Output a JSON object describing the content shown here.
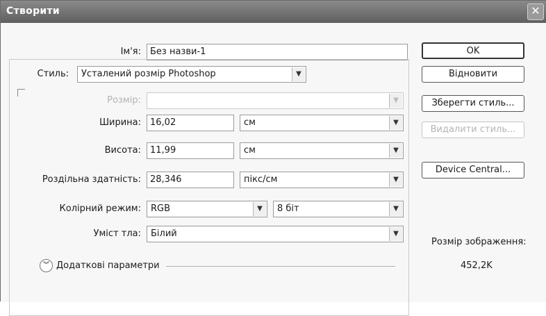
{
  "window": {
    "title": "Створити",
    "close_glyph": "✕"
  },
  "form": {
    "name_label": "Ім'я:",
    "name_value": "Без назви-1",
    "style_label": "Стиль:",
    "style_value": "Усталений розмір Photoshop",
    "size_label": "Розмір:",
    "size_value": "",
    "width_label": "Ширина:",
    "width_value": "16,02",
    "width_unit": "см",
    "height_label": "Висота:",
    "height_value": "11,99",
    "height_unit": "см",
    "resolution_label": "Роздільна здатність:",
    "resolution_value": "28,346",
    "resolution_unit": "пікс/см",
    "colormode_label": "Колірний режим:",
    "colormode_value": "RGB",
    "bitdepth_value": "8 біт",
    "background_label": "Уміст тла:",
    "background_value": "Білий",
    "advanced_label": "Додаткові параметри"
  },
  "buttons": {
    "ok": "OK",
    "reset": "Відновити",
    "save_style": "Зберегти стиль...",
    "delete_style": "Видалити стиль...",
    "device_central": "Device Central..."
  },
  "info": {
    "image_size_label": "Розмір зображення:",
    "image_size_value": "452,2K"
  },
  "icons": {
    "dropdown": "chevron-down-icon",
    "expand": "double-chevron-down-icon"
  }
}
